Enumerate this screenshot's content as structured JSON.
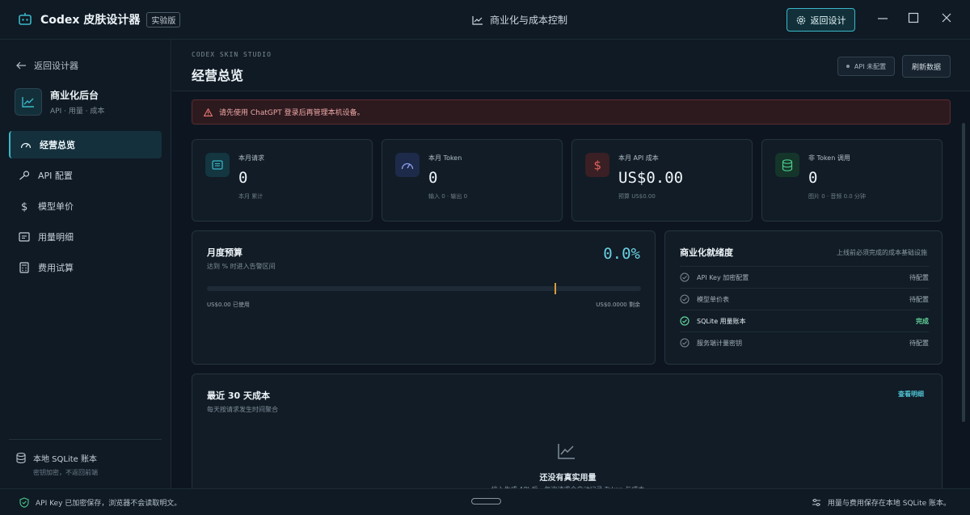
{
  "app": {
    "name": "Codex 皮肤设计器",
    "badge": "实验版"
  },
  "titlebar": {
    "center_title": "商业化与成本控制",
    "back_button": "返回设计"
  },
  "sidebar": {
    "back_link": "返回设计器",
    "app_title": "商业化后台",
    "app_subtitle": "API · 用量 · 成本",
    "items": [
      {
        "label": "经营总览",
        "icon": "gauge-icon",
        "active": true
      },
      {
        "label": "API 配置",
        "icon": "key-icon",
        "active": false
      },
      {
        "label": "模型单价",
        "icon": "dollar-icon",
        "active": false
      },
      {
        "label": "用量明细",
        "icon": "list-icon",
        "active": false
      },
      {
        "label": "费用试算",
        "icon": "calculator-icon",
        "active": false
      }
    ],
    "storage_title": "本地 SQLite 账本",
    "storage_subtitle": "密钥加密，不返回前端"
  },
  "header": {
    "kicker": "CODEX SKIN STUDIO",
    "title": "经营总览",
    "api_status": "API 未配置",
    "refresh_label": "刷新数据"
  },
  "alert": {
    "text": "请先使用 ChatGPT 登录后再管理本机设备。"
  },
  "stats": [
    {
      "label": "本月请求",
      "value": "0",
      "sub": "本月 累计",
      "icon": "message-icon",
      "color": "#3bb7c8"
    },
    {
      "label": "本月 Token",
      "value": "0",
      "sub": "输入 0 · 输出 0",
      "icon": "gauge-icon",
      "color": "#7f93e6"
    },
    {
      "label": "本月 API 成本",
      "value": "US$0.00",
      "sub": "预算 US$0.00",
      "icon": "dollar-icon",
      "color": "#e0625a"
    },
    {
      "label": "非 Token 调用",
      "value": "0",
      "sub": "图片 0 · 音频 0.0 分钟",
      "icon": "database-icon",
      "color": "#4cc98a"
    }
  ],
  "budget": {
    "title": "月度预算",
    "subtitle": "达到 % 时进入告警区间",
    "percent_text": "0.0%",
    "used_fraction": 0.0,
    "alert_fraction": 0.8,
    "used_text": "US$0.00 已使用",
    "remaining_text": "US$0.0000 剩余"
  },
  "readiness": {
    "title": "商业化就绪度",
    "note": "上线前必须完成的成本基础设施",
    "items": [
      {
        "label": "API Key 加密配置",
        "state": "待配置",
        "done": false
      },
      {
        "label": "模型单价表",
        "state": "待配置",
        "done": false
      },
      {
        "label": "SQLite 用量账本",
        "state": "完成",
        "done": true
      },
      {
        "label": "服务端计量密钥",
        "state": "待配置",
        "done": false
      }
    ]
  },
  "cost": {
    "title": "最近 30 天成本",
    "subtitle": "每天按请求发生时间聚合",
    "link": "查看明细",
    "empty_title": "还没有真实用量",
    "empty_subtitle": "接入生成 API 后，每次请求会自动记录 Token 与成本"
  },
  "statusbar": {
    "left": "API Key 已加密保存，浏览器不会读取明文。",
    "right": "用量与费用保存在本地 SQLite 账本。"
  },
  "colors": {
    "accent": "#3bb7c8",
    "success": "#62d39a",
    "danger": "#e0625a",
    "warn": "#d99a3a"
  }
}
